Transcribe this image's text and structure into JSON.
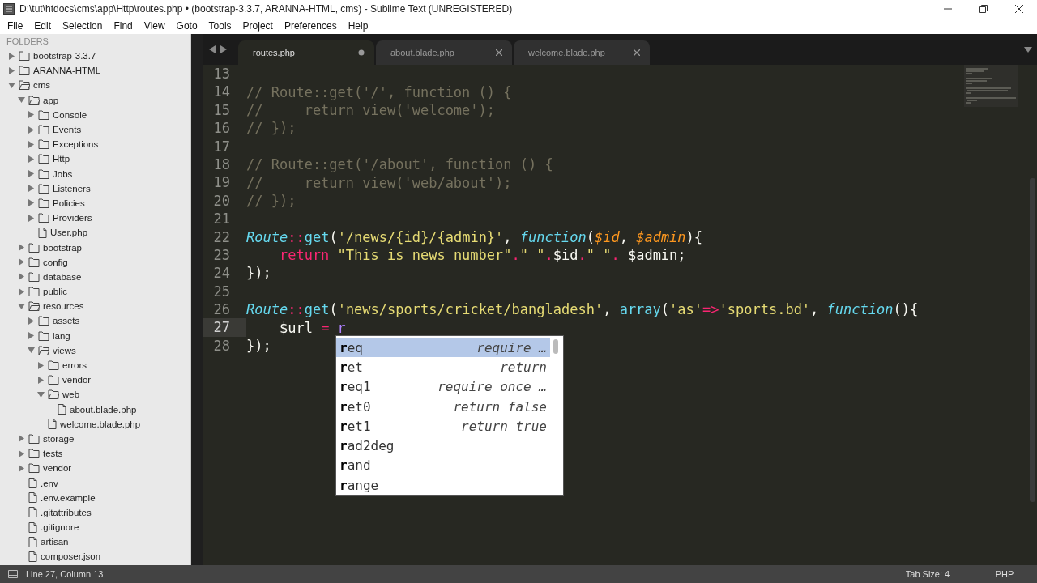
{
  "window": {
    "title": "D:\\tut\\htdocs\\cms\\app\\Http\\routes.php • (bootstrap-3.3.7, ARANNA-HTML, cms) - Sublime Text (UNREGISTERED)"
  },
  "menu": [
    "File",
    "Edit",
    "Selection",
    "Find",
    "View",
    "Goto",
    "Tools",
    "Project",
    "Preferences",
    "Help"
  ],
  "sidebar": {
    "header": "FOLDERS",
    "items": [
      {
        "name": "bootstrap-3.3.7",
        "kind": "folder",
        "expanded": false
      },
      {
        "name": "ARANNA-HTML",
        "kind": "folder",
        "expanded": false
      },
      {
        "name": "cms",
        "kind": "folder",
        "expanded": true,
        "children": [
          {
            "name": "app",
            "kind": "folder",
            "expanded": true,
            "children": [
              {
                "name": "Console",
                "kind": "folder",
                "expanded": false
              },
              {
                "name": "Events",
                "kind": "folder",
                "expanded": false
              },
              {
                "name": "Exceptions",
                "kind": "folder",
                "expanded": false
              },
              {
                "name": "Http",
                "kind": "folder",
                "expanded": false
              },
              {
                "name": "Jobs",
                "kind": "folder",
                "expanded": false
              },
              {
                "name": "Listeners",
                "kind": "folder",
                "expanded": false
              },
              {
                "name": "Policies",
                "kind": "folder",
                "expanded": false
              },
              {
                "name": "Providers",
                "kind": "folder",
                "expanded": false
              },
              {
                "name": "User.php",
                "kind": "file"
              }
            ]
          },
          {
            "name": "bootstrap",
            "kind": "folder",
            "expanded": false
          },
          {
            "name": "config",
            "kind": "folder",
            "expanded": false
          },
          {
            "name": "database",
            "kind": "folder",
            "expanded": false
          },
          {
            "name": "public",
            "kind": "folder",
            "expanded": false
          },
          {
            "name": "resources",
            "kind": "folder",
            "expanded": true,
            "children": [
              {
                "name": "assets",
                "kind": "folder",
                "expanded": false
              },
              {
                "name": "lang",
                "kind": "folder",
                "expanded": false
              },
              {
                "name": "views",
                "kind": "folder",
                "expanded": true,
                "children": [
                  {
                    "name": "errors",
                    "kind": "folder",
                    "expanded": false
                  },
                  {
                    "name": "vendor",
                    "kind": "folder",
                    "expanded": false
                  },
                  {
                    "name": "web",
                    "kind": "folder",
                    "expanded": true,
                    "children": [
                      {
                        "name": "about.blade.php",
                        "kind": "file"
                      }
                    ]
                  },
                  {
                    "name": "welcome.blade.php",
                    "kind": "file"
                  }
                ]
              }
            ]
          },
          {
            "name": "storage",
            "kind": "folder",
            "expanded": false
          },
          {
            "name": "tests",
            "kind": "folder",
            "expanded": false
          },
          {
            "name": "vendor",
            "kind": "folder",
            "expanded": false
          },
          {
            "name": ".env",
            "kind": "file"
          },
          {
            "name": ".env.example",
            "kind": "file"
          },
          {
            "name": ".gitattributes",
            "kind": "file"
          },
          {
            "name": ".gitignore",
            "kind": "file"
          },
          {
            "name": "artisan",
            "kind": "file"
          },
          {
            "name": "composer.json",
            "kind": "file"
          }
        ]
      }
    ]
  },
  "tabs": [
    {
      "label": "routes.php",
      "selected": true,
      "modified": true
    },
    {
      "label": "about.blade.php",
      "selected": false,
      "modified": false
    },
    {
      "label": "welcome.blade.php",
      "selected": false,
      "modified": false
    }
  ],
  "editor": {
    "lines": [
      {
        "number": "13",
        "current": false
      },
      {
        "number": "14",
        "current": false,
        "tokens": [
          {
            "kind": "comment",
            "text": "// Route::get('/', function () {"
          }
        ]
      },
      {
        "number": "15",
        "current": false,
        "tokens": [
          {
            "kind": "comment",
            "text": "//     return view('welcome');"
          }
        ]
      },
      {
        "number": "16",
        "current": false,
        "tokens": [
          {
            "kind": "comment",
            "text": "// });"
          }
        ]
      },
      {
        "number": "17",
        "current": false
      },
      {
        "number": "18",
        "current": false,
        "tokens": [
          {
            "kind": "comment",
            "text": "// Route::get('/about', function () {"
          }
        ]
      },
      {
        "number": "19",
        "current": false,
        "tokens": [
          {
            "kind": "comment",
            "text": "//     return view('web/about');"
          }
        ]
      },
      {
        "number": "20",
        "current": false,
        "tokens": [
          {
            "kind": "comment",
            "text": "// });"
          }
        ]
      },
      {
        "number": "21",
        "current": false
      },
      {
        "number": "22",
        "current": false,
        "tokens": [
          {
            "kind": "class",
            "text": "Route"
          },
          {
            "kind": "operator",
            "text": "::"
          },
          {
            "kind": "function",
            "text": "get"
          },
          {
            "kind": "plain",
            "text": "("
          },
          {
            "kind": "string",
            "text": "'/news/{id}/{admin}'"
          },
          {
            "kind": "plain",
            "text": ", "
          },
          {
            "kind": "storage",
            "text": "function"
          },
          {
            "kind": "plain",
            "text": "("
          },
          {
            "kind": "parameter",
            "text": "$id"
          },
          {
            "kind": "plain",
            "text": ", "
          },
          {
            "kind": "parameter",
            "text": "$admin"
          },
          {
            "kind": "plain",
            "text": "){"
          }
        ]
      },
      {
        "number": "23",
        "current": false,
        "tokens": [
          {
            "kind": "keyword",
            "text": "    return"
          },
          {
            "kind": "string",
            "text": " \"This is news number\""
          },
          {
            "kind": "operator",
            "text": "."
          },
          {
            "kind": "string",
            "text": "\" \""
          },
          {
            "kind": "operator",
            "text": "."
          },
          {
            "kind": "plain",
            "text": "$id"
          },
          {
            "kind": "operator",
            "text": "."
          },
          {
            "kind": "string",
            "text": "\" \""
          },
          {
            "kind": "operator",
            "text": "."
          },
          {
            "kind": "plain",
            "text": " $admin;"
          }
        ]
      },
      {
        "number": "24",
        "current": false,
        "tokens": [
          {
            "kind": "plain",
            "text": "});"
          }
        ]
      },
      {
        "number": "25",
        "current": false
      },
      {
        "number": "26",
        "current": false,
        "tokens": [
          {
            "kind": "class",
            "text": "Route"
          },
          {
            "kind": "operator",
            "text": "::"
          },
          {
            "kind": "function",
            "text": "get"
          },
          {
            "kind": "plain",
            "text": "("
          },
          {
            "kind": "string",
            "text": "'news/sports/cricket/bangladesh'"
          },
          {
            "kind": "plain",
            "text": ", "
          },
          {
            "kind": "function",
            "text": "array"
          },
          {
            "kind": "plain",
            "text": "("
          },
          {
            "kind": "string",
            "text": "'as'"
          },
          {
            "kind": "operator",
            "text": "=>"
          },
          {
            "kind": "string",
            "text": "'sports.bd'"
          },
          {
            "kind": "plain",
            "text": ", "
          },
          {
            "kind": "storage",
            "text": "function"
          },
          {
            "kind": "plain",
            "text": "(){"
          }
        ]
      },
      {
        "number": "27",
        "current": true,
        "tokens": [
          {
            "kind": "plain",
            "text": "    $url "
          },
          {
            "kind": "operator",
            "text": "="
          },
          {
            "kind": "constant",
            "text": " r"
          }
        ]
      },
      {
        "number": "28",
        "current": false,
        "tokens": [
          {
            "kind": "plain",
            "text": "});"
          }
        ]
      }
    ]
  },
  "autocomplete": [
    {
      "trigger": "**r**eq",
      "hint": "require …",
      "selected": true
    },
    {
      "trigger": "**r**et",
      "hint": "return",
      "selected": false
    },
    {
      "trigger": "**r**eq1",
      "hint": "require_once …",
      "selected": false
    },
    {
      "trigger": "**r**et0",
      "hint": "return false",
      "selected": false
    },
    {
      "trigger": "**r**et1",
      "hint": "return true",
      "selected": false
    },
    {
      "trigger": "**r**ad2deg",
      "selected": false
    },
    {
      "trigger": "**r**and",
      "selected": false
    },
    {
      "trigger": "**r**ange",
      "selected": false
    }
  ],
  "status_bar": {
    "position": "Line 27, Column 13",
    "tab_size": "Tab Size: 4",
    "syntax": "PHP"
  }
}
